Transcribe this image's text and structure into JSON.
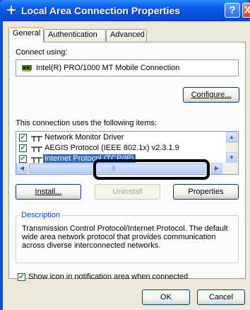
{
  "window": {
    "title": "Local Area Connection Properties",
    "help_glyph": "?",
    "close_glyph": "X"
  },
  "tabs": [
    {
      "label": "General",
      "active": true
    },
    {
      "label": "Authentication",
      "active": false
    },
    {
      "label": "Advanced",
      "active": false
    }
  ],
  "connect_using": {
    "label": "Connect using:",
    "adapter": "Intel(R) PRO/1000 MT Mobile Connection",
    "adapter_icon": "network-card-icon",
    "configure_button": "Configure..."
  },
  "items": {
    "label": "This connection uses the following items:",
    "list": [
      {
        "label": "Network Monitor Driver",
        "checked": true,
        "selected": false
      },
      {
        "label": "AEGIS Protocol (IEEE 802.1x) v2.3.1.9",
        "checked": true,
        "selected": false
      },
      {
        "label": "Internet Protocol (TCP/IP)",
        "checked": true,
        "selected": true
      }
    ],
    "check_glyph": "✔",
    "protocol_icon": "network-protocol-icon"
  },
  "buttons": {
    "install": "Install...",
    "uninstall": "Uninstall",
    "properties": "Properties",
    "ok": "OK",
    "cancel": "Cancel"
  },
  "description": {
    "title": "Description",
    "text": "Transmission Control Protocol/Internet Protocol. The default wide area network protocol that provides communication across diverse interconnected networks."
  },
  "notification_checkbox": {
    "label": "Show icon in notification area when connected",
    "checked": true
  },
  "scroll_glyphs": {
    "up": "▲",
    "down": "▼",
    "left": "◀",
    "right": "▶",
    "thumb_grip": "||||"
  },
  "colors": {
    "titlebar": "#0645cf",
    "selection": "#316ac5",
    "tab_highlight": "#ffc83c"
  }
}
